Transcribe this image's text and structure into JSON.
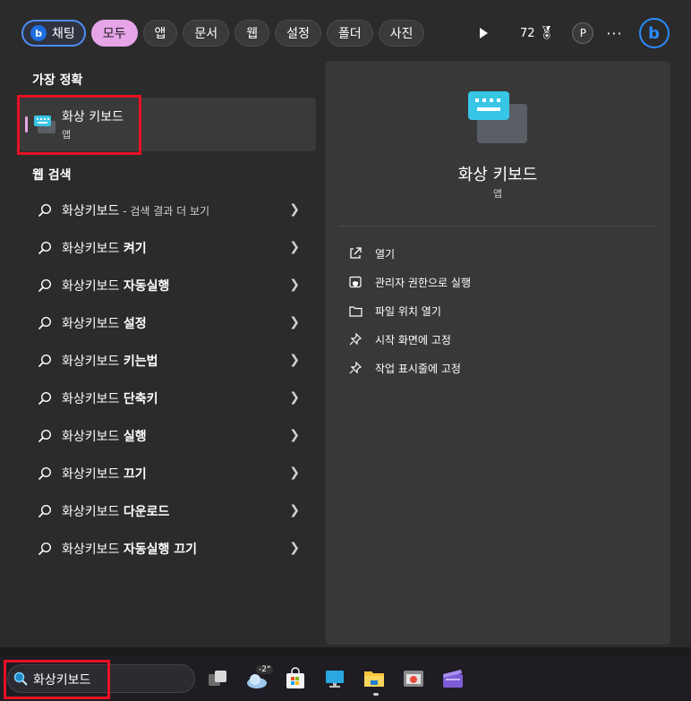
{
  "filters": {
    "chat": "채팅",
    "all": "모두",
    "apps": "앱",
    "docs": "문서",
    "web": "웹",
    "settings": "설정",
    "folders": "폴더",
    "photos": "사진"
  },
  "toolbar": {
    "points": "72",
    "avatar_letter": "P",
    "more": "···",
    "bing_letter": "b"
  },
  "best_match": {
    "heading": "가장 정확",
    "title": "화상 키보드",
    "subtitle": "앱"
  },
  "web_search": {
    "heading": "웹 검색",
    "items": [
      {
        "prefix": "화상키보드",
        "bold": "",
        "suffix": " - 검색 결과 더 보기"
      },
      {
        "prefix": "화상키보드 ",
        "bold": "켜기",
        "suffix": ""
      },
      {
        "prefix": "화상키보드 ",
        "bold": "자동실행",
        "suffix": ""
      },
      {
        "prefix": "화상키보드 ",
        "bold": "설정",
        "suffix": ""
      },
      {
        "prefix": "화상키보드 ",
        "bold": "키는법",
        "suffix": ""
      },
      {
        "prefix": "화상키보드 ",
        "bold": "단축키",
        "suffix": ""
      },
      {
        "prefix": "화상키보드 ",
        "bold": "실행",
        "suffix": ""
      },
      {
        "prefix": "화상키보드 ",
        "bold": "끄기",
        "suffix": ""
      },
      {
        "prefix": "화상키보드 ",
        "bold": "다운로드",
        "suffix": ""
      },
      {
        "prefix": "화상키보드 ",
        "bold": "자동실행 끄기",
        "suffix": ""
      }
    ]
  },
  "detail": {
    "title": "화상 키보드",
    "subtitle": "앱",
    "actions": {
      "open": "열기",
      "run_admin": "관리자 권한으로 실행",
      "open_location": "파일 위치 열기",
      "pin_start": "시작 화면에 고정",
      "pin_taskbar": "작업 표시줄에 고정"
    }
  },
  "taskbar": {
    "search_value": "화상키보드",
    "weather_temp": "-2°"
  },
  "colors": {
    "accent_pink": "#e5a5e8",
    "bing_blue": "#2a8cff",
    "highlight_red": "#e81123"
  }
}
